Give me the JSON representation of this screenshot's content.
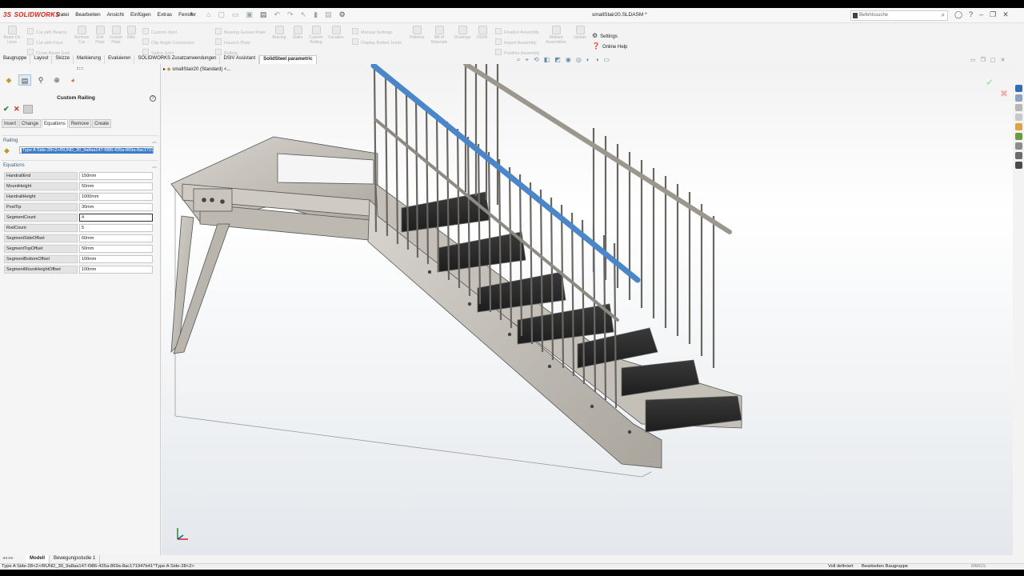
{
  "app": {
    "logo": "SOLIDWORKS",
    "document_title": "smallStair20.SLDASM *",
    "menu": [
      "Datei",
      "Bearbeiten",
      "Ansicht",
      "Einfügen",
      "Extras",
      "Fenster"
    ],
    "search_placeholder": "Befehlssuche"
  },
  "ribbon": {
    "big_buttons": [
      {
        "label": "Beam On Lines",
        "icon": "beam-icon"
      },
      {
        "label": "Remove Cut",
        "icon": "remove-cut-icon"
      },
      {
        "label": "End Plate",
        "icon": "end-plate-icon"
      },
      {
        "label": "Gusset Plate",
        "icon": "gusset-plate-icon"
      },
      {
        "label": "Ribs",
        "icon": "ribs-icon"
      },
      {
        "label": "Bracing",
        "icon": "bracing-icon"
      },
      {
        "label": "Stairs",
        "icon": "stairs-icon"
      },
      {
        "label": "Custom Railing",
        "icon": "railing-icon"
      },
      {
        "label": "Facades",
        "icon": "facades-icon"
      },
      {
        "label": "Patterns",
        "icon": "patterns-icon"
      },
      {
        "label": "Bill of Materials",
        "icon": "bom-icon"
      },
      {
        "label": "Drawings",
        "icon": "drawings-icon"
      },
      {
        "label": "DSNF",
        "icon": "dsnf-icon"
      },
      {
        "label": "Welded Assemblies",
        "icon": "welded-icon"
      },
      {
        "label": "Update",
        "icon": "update-icon"
      }
    ],
    "small_rows": [
      "Cut with Beams",
      "Cut with Face",
      "Cross Beam End",
      "Custom Joint",
      "Clip Angle Connection",
      "Splice Joint",
      "Bearing Gusset Plate",
      "Haunch Plate",
      "Bolting",
      "Manual Settings",
      "Display Bolted Joints",
      "Finalize Assembly",
      "Import Assembly",
      "Position Assembly"
    ],
    "settings_label": "Settings",
    "online_help_label": "Online Help"
  },
  "tabs": [
    "Baugruppe",
    "Layout",
    "Skizze",
    "Markierung",
    "Evaluieren",
    "SOLIDWORKS Zusatzanwendungen",
    "DSIV Assistant",
    "SolidSteel parametric"
  ],
  "active_tab": "SolidSteel parametric",
  "property_manager": {
    "title": "Custom Railing",
    "sub_tabs": [
      "Insert",
      "Change",
      "Equations",
      "Remove",
      "Create"
    ],
    "active_sub_tab": "Equations",
    "railing_section": "Railing",
    "railing_selection": "Type A Side-28<2>/RUND_30_9a8aa147-f986-435a-869a-8ac171947b41",
    "equations_section": "Equations",
    "equations": [
      {
        "name": "HandrailEnd",
        "value": "150mm"
      },
      {
        "name": "MountHeight",
        "value": "50mm"
      },
      {
        "name": "HandrailHeight",
        "value": "1000mm"
      },
      {
        "name": "PostTip",
        "value": "30mm"
      },
      {
        "name": "SegmentCount",
        "value": "4"
      },
      {
        "name": "RodCount",
        "value": "5"
      },
      {
        "name": "SegmentSideOffset",
        "value": "60mm"
      },
      {
        "name": "SegmentTopOffset",
        "value": "50mm"
      },
      {
        "name": "SegmentBottomOffset",
        "value": "100mm"
      },
      {
        "name": "SegmentMountHeightOffset",
        "value": "100mm"
      }
    ]
  },
  "viewport": {
    "tree_flyout": "smallStair20 (Standard) <..."
  },
  "bottom_tabs": [
    "Modell",
    "Bewegungsstudie 1"
  ],
  "status": {
    "selection": "Type A Side-28<2>/RUND_30_9a8aa147-f986-435a-869a-8ac171947b41^Type A Side-28<2>",
    "definition": "Voll definiert",
    "mode": "Bearbeiten Baugruppe",
    "units": "MMGS"
  },
  "colors": {
    "brand": "#d52b1e",
    "selection": "#3d7cc9",
    "steel": "#c8c4bb",
    "handrail_highlight": "#4a86c8"
  }
}
